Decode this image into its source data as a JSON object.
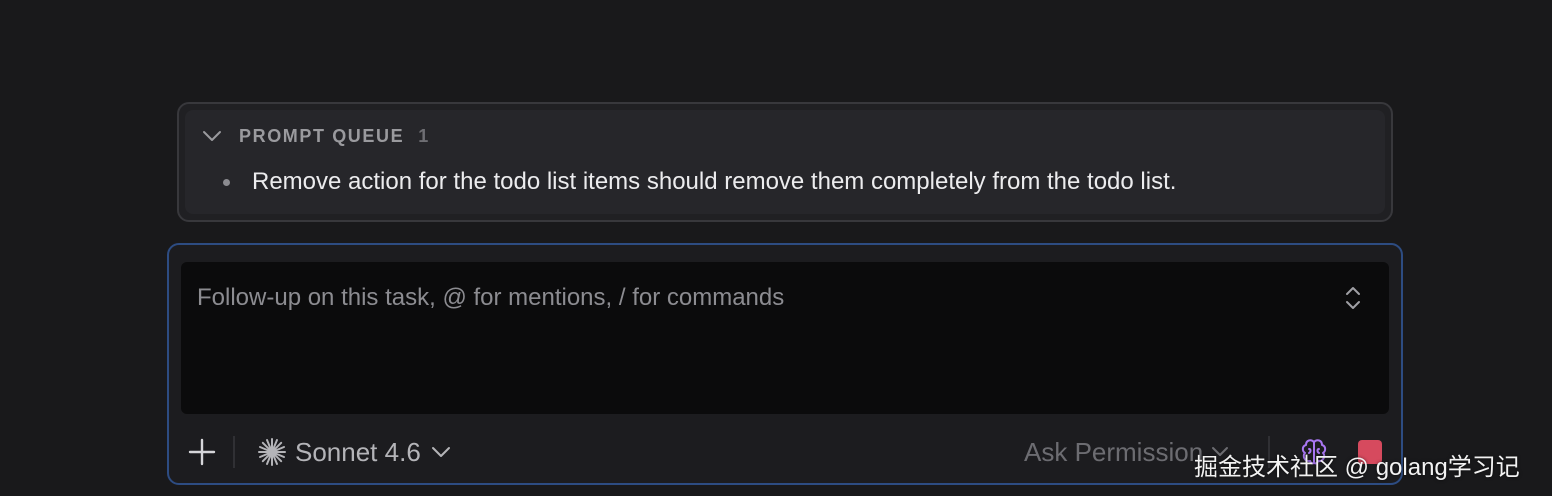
{
  "prompt_queue": {
    "title": "PROMPT QUEUE",
    "count": "1",
    "items": [
      {
        "text": "Remove action for the todo list items should remove them completely from the todo list."
      }
    ]
  },
  "composer": {
    "placeholder": "Follow-up on this task, @ for mentions, / for commands",
    "value": ""
  },
  "toolbar": {
    "model_label": "Sonnet 4.6",
    "permission_label": "Ask Permission"
  },
  "watermark": "掘金技术社区 @ golang学习记",
  "icons": {
    "queue_toggle": "chevron-down-icon",
    "expand": "expand-collapse-icon",
    "add": "plus-icon",
    "model": "sparkle-icon",
    "model_dropdown": "chevron-down-icon",
    "permission_dropdown": "chevron-down-icon",
    "thinking": "brain-icon",
    "stop": "stop-icon"
  },
  "colors": {
    "background": "#19191b",
    "composer_border": "#2d4c82",
    "stop_button": "#d64a5e",
    "brain_icon": "#a977f2"
  }
}
